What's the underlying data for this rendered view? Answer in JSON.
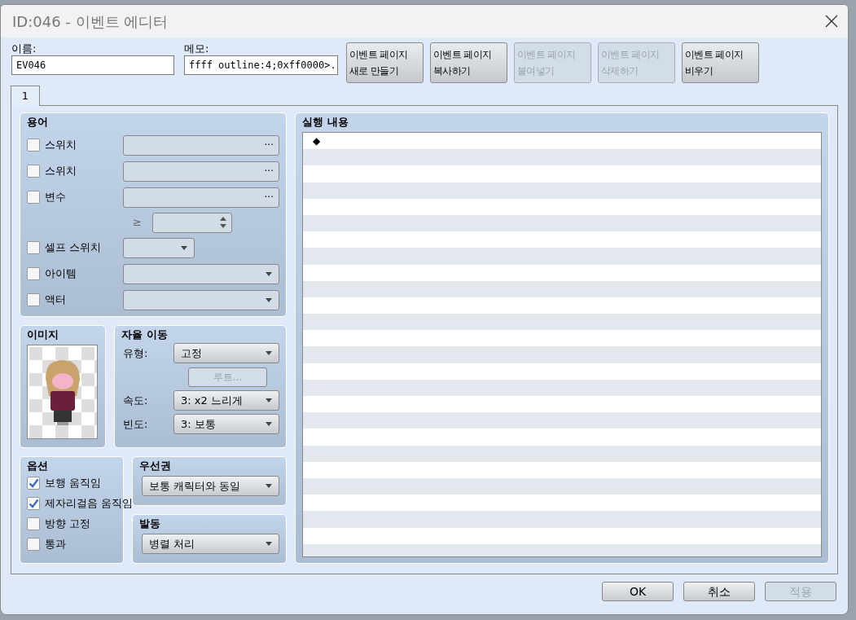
{
  "window": {
    "title": "ID:046 - 이벤트 에디터"
  },
  "name_field": {
    "label": "이름:",
    "value": "EV046"
  },
  "memo_field": {
    "label": "메모:",
    "value": "ffff outline:4;0xff0000>."
  },
  "page_buttons": [
    {
      "lines": [
        "이벤트 페이지",
        "새로 만들기"
      ],
      "disabled": false
    },
    {
      "lines": [
        "이벤트 페이지",
        "복사하기"
      ],
      "disabled": false
    },
    {
      "lines": [
        "이벤트 페이지",
        "붙여넣기"
      ],
      "disabled": true
    },
    {
      "lines": [
        "이벤트 페이지",
        "삭제하기"
      ],
      "disabled": true
    },
    {
      "lines": [
        "이벤트 페이지",
        "비우기"
      ],
      "disabled": false
    }
  ],
  "tabs": [
    {
      "label": "1",
      "selected": true
    }
  ],
  "conditions": {
    "title": "용어",
    "rows": [
      {
        "kind": "picker",
        "label": "스위치",
        "checked": false,
        "button": "···"
      },
      {
        "kind": "picker",
        "label": "스위치",
        "checked": false,
        "button": "···"
      },
      {
        "kind": "picker",
        "label": "변수",
        "checked": false,
        "button": "···"
      },
      {
        "kind": "compare",
        "symbol": "≥"
      },
      {
        "kind": "short_select",
        "label": "셀프 스위치",
        "checked": false
      },
      {
        "kind": "select",
        "label": "아이템",
        "checked": false
      },
      {
        "kind": "select",
        "label": "액터",
        "checked": false
      }
    ]
  },
  "image": {
    "title": "이미지"
  },
  "autonomous": {
    "title": "자율 이동",
    "rows": [
      {
        "kind": "select",
        "label": "유형:",
        "value": "고정"
      },
      {
        "kind": "button",
        "value": "루트...",
        "disabled": true
      },
      {
        "kind": "select",
        "label": "속도:",
        "value": "3: x2 느리게"
      },
      {
        "kind": "select",
        "label": "빈도:",
        "value": "3: 보통"
      }
    ]
  },
  "options": {
    "title": "옵션",
    "items": [
      {
        "label": "보행 움직임",
        "checked": true
      },
      {
        "label": "제자리걸음 움직임",
        "checked": true
      },
      {
        "label": "방향 고정",
        "checked": false
      },
      {
        "label": "통과",
        "checked": false
      }
    ]
  },
  "priority": {
    "title": "우선권",
    "value": "보통 캐릭터와 동일"
  },
  "trigger": {
    "title": "발동",
    "value": "병렬 처리"
  },
  "contents": {
    "title": "실행 내용",
    "lines": [
      "◆"
    ]
  },
  "footer_buttons": [
    {
      "label": "OK",
      "disabled": false
    },
    {
      "label": "취소",
      "disabled": false
    },
    {
      "label": "적용",
      "disabled": true
    }
  ]
}
